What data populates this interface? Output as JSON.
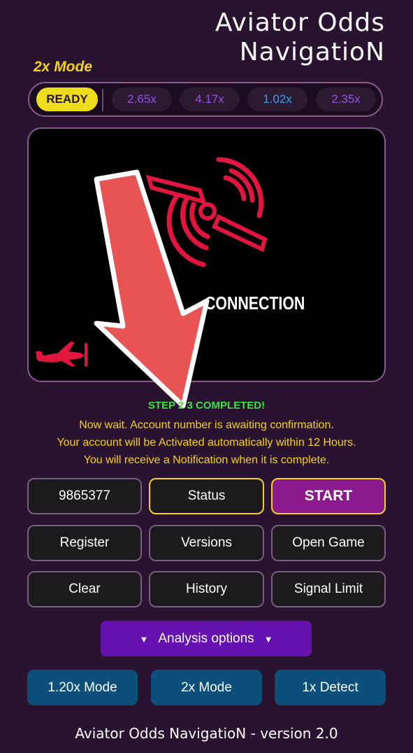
{
  "header": {
    "title_line1": "Aviator Odds",
    "title_line2": "NavigatioN"
  },
  "mode_label": "2x Mode",
  "odds_bar": {
    "ready": "READY",
    "odds": [
      {
        "value": "2.65x",
        "color": "#9b4fe6"
      },
      {
        "value": "4.17x",
        "color": "#9b4fe6"
      },
      {
        "value": "1.02x",
        "color": "#3aa0f0"
      },
      {
        "value": "2.35x",
        "color": "#9b4fe6"
      }
    ]
  },
  "stage": {
    "connection_text": "CONNECTION",
    "icons": [
      "propeller-signal-icon",
      "plane-icon"
    ]
  },
  "messages": {
    "step": "STEP 2 3 COMPLETED!",
    "line1": "Now wait. Account number is awaiting confirmation.",
    "line2": "Your account will be Activated automatically within 12 Hours.",
    "line3": "You will receive a Notification when it is complete."
  },
  "buttons": {
    "account_number": "9865377",
    "status": "Status",
    "start": "START",
    "register": "Register",
    "versions": "Versions",
    "open_game": "Open Game",
    "clear": "Clear",
    "history": "History",
    "signal_limit": "Signal Limit",
    "analysis": "Analysis options",
    "analysis_arrow": "▼",
    "mode_120": "1.20x Mode",
    "mode_2x": "2x Mode",
    "detect_1x": "1x Detect"
  },
  "footer": {
    "text": "Aviator Odds NavigatioN -  version 2.0"
  },
  "colors": {
    "background": "#2a1330",
    "accent_yellow": "#f5d21a",
    "start_purple": "#8b1a8e",
    "analysis_purple": "#6512b0",
    "mode_blue": "#0c4f7a",
    "step_green": "#3ee23e",
    "icon_red": "#e0163f",
    "overlay_arrow": "#e85454"
  }
}
